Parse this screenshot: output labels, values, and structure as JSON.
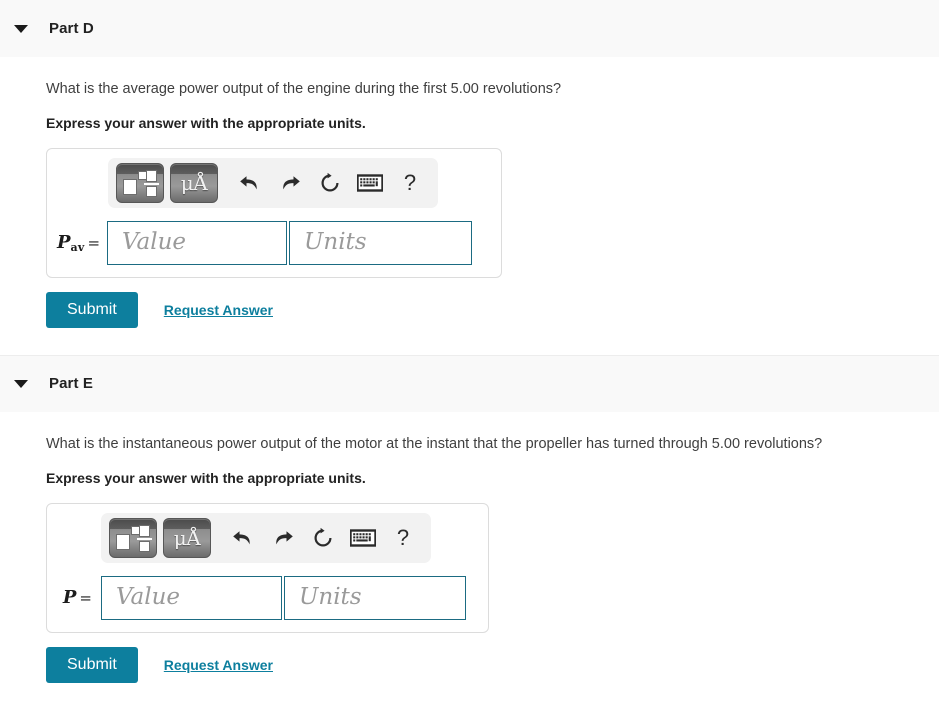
{
  "page": {
    "background": "#ffffff",
    "accent_color": "#0d7f9e",
    "header_background": "#f9f9f9",
    "field_border_color": "#1b6b82"
  },
  "parts": [
    {
      "id": "part-d",
      "header": {
        "title": "Part D",
        "caret_icon": "caret-down-icon"
      },
      "question": "What is the average power output of the engine during the first 5.00 revolutions?",
      "instruction": "Express your answer with the appropriate units.",
      "toolbar": {
        "buttons": [
          {
            "name": "math-template-button",
            "label": ""
          },
          {
            "name": "units-button",
            "label": "μÅ"
          }
        ],
        "icons": [
          {
            "name": "undo-icon",
            "label": "undo"
          },
          {
            "name": "redo-icon",
            "label": "redo"
          },
          {
            "name": "reset-icon",
            "label": "reset"
          },
          {
            "name": "keyboard-icon",
            "label": "keyboard"
          },
          {
            "name": "help-icon",
            "label": "?"
          }
        ]
      },
      "variable": {
        "symbol": "P",
        "subscript": "av",
        "equals": "="
      },
      "fields": {
        "value_placeholder": "Value",
        "value": "",
        "units_placeholder": "Units",
        "units": ""
      },
      "actions": {
        "submit_label": "Submit",
        "request_answer_label": "Request Answer"
      }
    },
    {
      "id": "part-e",
      "header": {
        "title": "Part E",
        "caret_icon": "caret-down-icon"
      },
      "question": "What is the instantaneous power output of the motor at the instant that the propeller has turned through 5.00 revolutions?",
      "instruction": "Express your answer with the appropriate units.",
      "toolbar": {
        "buttons": [
          {
            "name": "math-template-button",
            "label": ""
          },
          {
            "name": "units-button",
            "label": "μÅ"
          }
        ],
        "icons": [
          {
            "name": "undo-icon",
            "label": "undo"
          },
          {
            "name": "redo-icon",
            "label": "redo"
          },
          {
            "name": "reset-icon",
            "label": "reset"
          },
          {
            "name": "keyboard-icon",
            "label": "keyboard"
          },
          {
            "name": "help-icon",
            "label": "?"
          }
        ]
      },
      "variable": {
        "symbol": "P",
        "subscript": "",
        "equals": "="
      },
      "fields": {
        "value_placeholder": "Value",
        "value": "",
        "units_placeholder": "Units",
        "units": ""
      },
      "actions": {
        "submit_label": "Submit",
        "request_answer_label": "Request Answer"
      }
    }
  ]
}
